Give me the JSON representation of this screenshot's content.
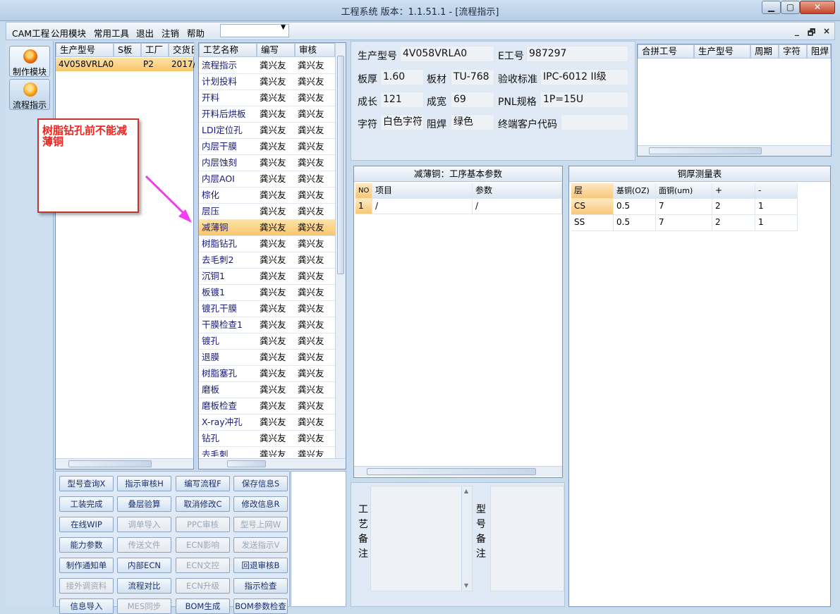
{
  "window": {
    "title": "工程系统  版本：1.1.51.1 - [流程指示]",
    "min": "▁",
    "max": "▢",
    "close": "✕"
  },
  "menu": [
    "CAM工程",
    "公用模块",
    "常用工具",
    "退出",
    "注销",
    "帮助"
  ],
  "mdi_controls": [
    "_",
    "🗗",
    "×"
  ],
  "modules": [
    {
      "label": "制作模块"
    },
    {
      "label": "流程指示"
    }
  ],
  "model_table": {
    "headers": [
      "生产型号",
      "S板",
      "工厂",
      "交货日"
    ],
    "rows": [
      [
        "4V058VRLA0",
        "",
        "P2",
        "2017/"
      ]
    ]
  },
  "process_table": {
    "headers": [
      "工艺名称",
      "编写",
      "审核"
    ],
    "rows": [
      [
        "流程指示",
        "龚兴友",
        "龚兴友"
      ],
      [
        "计划投料",
        "龚兴友",
        "龚兴友"
      ],
      [
        "开料",
        "龚兴友",
        "龚兴友"
      ],
      [
        "开料后烘板",
        "龚兴友",
        "龚兴友"
      ],
      [
        "LDI定位孔",
        "龚兴友",
        "龚兴友"
      ],
      [
        "内层干膜",
        "龚兴友",
        "龚兴友"
      ],
      [
        "内层蚀刻",
        "龚兴友",
        "龚兴友"
      ],
      [
        "内层AOI",
        "龚兴友",
        "龚兴友"
      ],
      [
        "棕化",
        "龚兴友",
        "龚兴友"
      ],
      [
        "层压",
        "龚兴友",
        "龚兴友"
      ],
      [
        "减薄铜",
        "龚兴友",
        "龚兴友"
      ],
      [
        "树脂钻孔",
        "龚兴友",
        "龚兴友"
      ],
      [
        "去毛刺2",
        "龚兴友",
        "龚兴友"
      ],
      [
        "沉铜1",
        "龚兴友",
        "龚兴友"
      ],
      [
        "板镀1",
        "龚兴友",
        "龚兴友"
      ],
      [
        "镀孔干膜",
        "龚兴友",
        "龚兴友"
      ],
      [
        "干膜检查1",
        "龚兴友",
        "龚兴友"
      ],
      [
        "镀孔",
        "龚兴友",
        "龚兴友"
      ],
      [
        "退膜",
        "龚兴友",
        "龚兴友"
      ],
      [
        "树脂塞孔",
        "龚兴友",
        "龚兴友"
      ],
      [
        "磨板",
        "龚兴友",
        "龚兴友"
      ],
      [
        "磨板检查",
        "龚兴友",
        "龚兴友"
      ],
      [
        "X-ray冲孔",
        "龚兴友",
        "龚兴友"
      ],
      [
        "钻孔",
        "龚兴友",
        "龚兴友"
      ],
      [
        "去毛刺",
        "龚兴友",
        "龚兴友"
      ]
    ],
    "selected_index": 10
  },
  "annotation": {
    "text": "树脂钻孔前不能减薄铜",
    "color": "#e8261f"
  },
  "info": {
    "labels": {
      "model": "生产型号",
      "eno": "E工号",
      "thick": "板厚",
      "mat": "板材",
      "std": "验收标准",
      "len": "成长",
      "wid": "成宽",
      "pnl": "PNL规格",
      "char": "字符",
      "mask": "阻焊",
      "endcode": "终端客户代码"
    },
    "values": {
      "model": "4V058VRLA0",
      "eno": "987297",
      "thick": "1.60",
      "mat": "TU-768",
      "std": "IPC-6012 II级",
      "len": "121",
      "wid": "69",
      "pnl": "1P=15U",
      "char": "白色字符",
      "mask": "绿色",
      "endcode": ""
    }
  },
  "merge_table": {
    "headers": [
      "合拼工号",
      "生产型号",
      "周期",
      "字符",
      "阻焊"
    ]
  },
  "params_panel": {
    "title": "减薄铜：工序基本参数",
    "headers": [
      "NO",
      "项目",
      "参数"
    ],
    "rows": [
      [
        "1",
        "/",
        "/"
      ]
    ]
  },
  "copper_panel": {
    "title": "铜厚测量表",
    "headers": [
      "层",
      "基铜(OZ)",
      "面铜(um)",
      "+",
      "-"
    ],
    "rows": [
      [
        "CS",
        "0.5",
        "7",
        "2",
        "1"
      ],
      [
        "SS",
        "0.5",
        "7",
        "2",
        "1"
      ]
    ]
  },
  "buttons": [
    [
      {
        "label": "型号查询X",
        "enabled": true
      },
      {
        "label": "指示审核H",
        "enabled": true
      },
      {
        "label": "编写流程F",
        "enabled": true
      },
      {
        "label": "保存信息S",
        "enabled": true
      }
    ],
    [
      {
        "label": "工装完成",
        "enabled": true
      },
      {
        "label": "叠层验算",
        "enabled": true
      },
      {
        "label": "取消修改C",
        "enabled": true
      },
      {
        "label": "修改信息R",
        "enabled": true
      }
    ],
    [
      {
        "label": "在线WIP",
        "enabled": true
      },
      {
        "label": "调单导入",
        "enabled": false
      },
      {
        "label": "PPC审核",
        "enabled": false
      },
      {
        "label": "型号上网W",
        "enabled": false
      }
    ],
    [
      {
        "label": "能力参数",
        "enabled": true
      },
      {
        "label": "传送文件",
        "enabled": false
      },
      {
        "label": "ECN影响",
        "enabled": false
      },
      {
        "label": "发送指示V",
        "enabled": false
      }
    ],
    [
      {
        "label": "制作通知单",
        "enabled": true
      },
      {
        "label": "内部ECN",
        "enabled": true
      },
      {
        "label": "ECN文控",
        "enabled": false
      },
      {
        "label": "回退审核B",
        "enabled": true
      }
    ],
    [
      {
        "label": "接外调资料",
        "enabled": false
      },
      {
        "label": "流程对比",
        "enabled": true
      },
      {
        "label": "ECN升级",
        "enabled": false
      },
      {
        "label": "指示检查",
        "enabled": true
      }
    ],
    [
      {
        "label": "信息导入",
        "enabled": true
      },
      {
        "label": "MES同步",
        "enabled": false
      },
      {
        "label": "BOM生成",
        "enabled": true
      },
      {
        "label": "BOM参数检查",
        "enabled": true
      }
    ]
  ],
  "notes": {
    "process_label": "工艺备注",
    "model_label": "型号备注"
  }
}
